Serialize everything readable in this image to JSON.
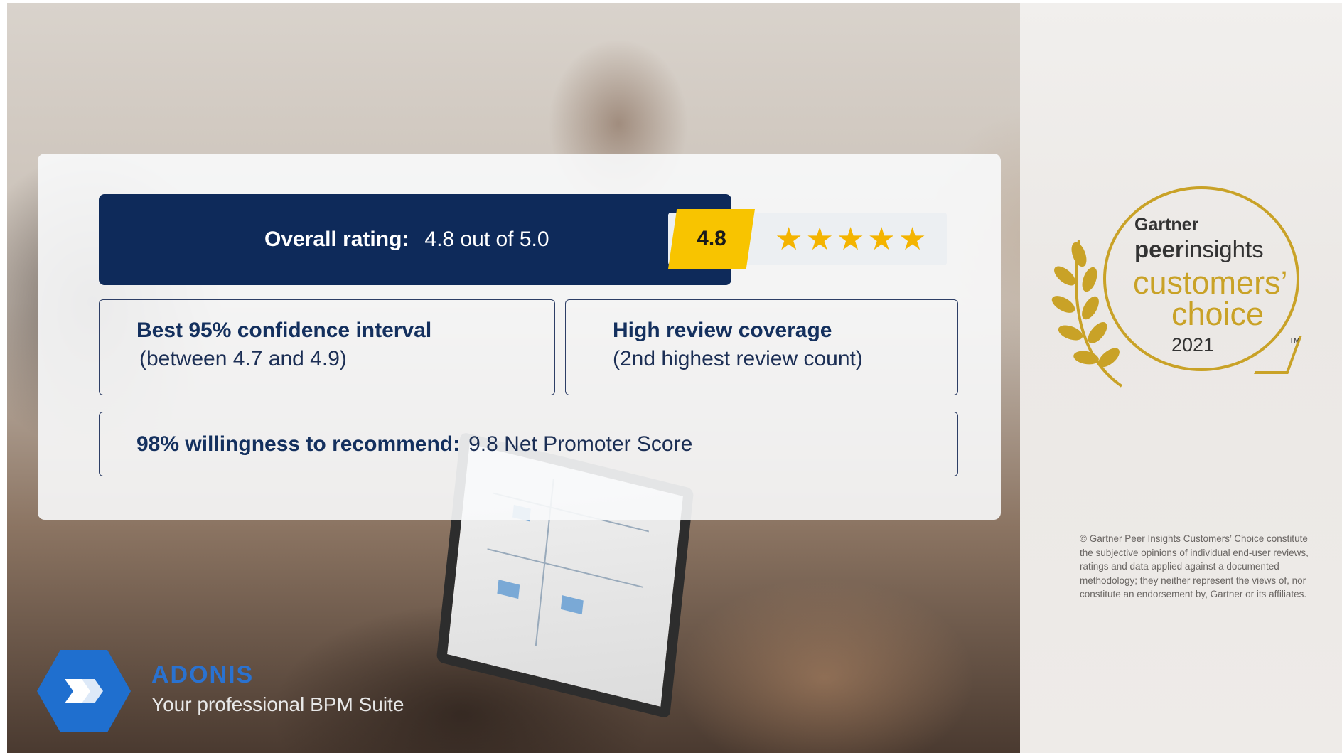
{
  "rating": {
    "label": "Overall rating:",
    "value_text": "4.8 out of 5.0",
    "badge": "4.8",
    "stars": 5,
    "star_color": "#f4b400"
  },
  "confidence": {
    "title": "Best 95% confidence interval",
    "sub": "(between 4.7 and 4.9)"
  },
  "coverage": {
    "title": "High review coverage",
    "sub": "(2nd highest review count)"
  },
  "recommend": {
    "title": "98% willingness to recommend:",
    "value": "9.8 Net Promoter Score"
  },
  "brand": {
    "name": "ADONIS",
    "tagline": "Your professional BPM Suite",
    "color": "#1f6fcf"
  },
  "badge": {
    "gartner": "Gartner",
    "peer_bold": "peer",
    "peer_rest": "insights",
    "line1": "customers’",
    "line2": "choice",
    "year": "2021",
    "tm": "TM",
    "gold": "#c9a227"
  },
  "disclaimer": "© Gartner Peer Insights Customers’ Choice constitute the subjective opinions of individual end-user reviews, ratings and data applied against a documented methodology; they neither represent the views of, nor constitute an endorsement by, Gartner or its affiliates.",
  "colors": {
    "navy": "#0e2a5a",
    "badge_yellow": "#f8c400"
  }
}
